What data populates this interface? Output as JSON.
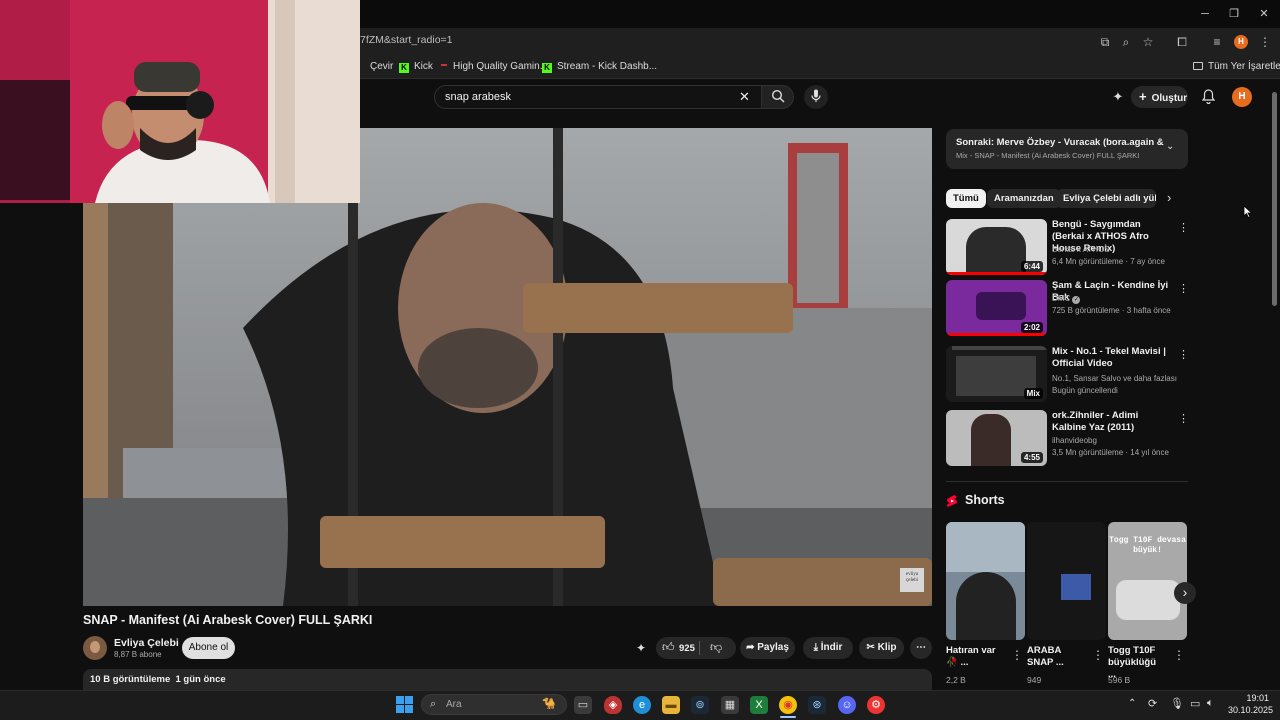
{
  "browser": {
    "url": "7fZM&start_radio=1",
    "bookmarks": [
      "Çevir",
      "Kick",
      "High Quality Gamin...",
      "Stream - Kick Dashb..."
    ],
    "all_bookmarks": "Tüm Yer İşaretleri",
    "profile_initial": "H"
  },
  "youtube": {
    "search_value": "snap arabesk",
    "create_label": "Oluştur",
    "avatar_initial": "H"
  },
  "video": {
    "title": "SNAP - Manifest (Ai Arabesk Cover) FULL ŞARKI",
    "channel": "Evliya Çelebi",
    "subscribers": "8,87 B abone",
    "subscribe_label": "Abone ol",
    "likes": "925",
    "share_label": "Paylaş",
    "download_label": "İndir",
    "clip_label": "Klip",
    "views_date": "10 B görüntüleme  1 gün önce"
  },
  "sidebar": {
    "next_title": "Sonraki: Merve Özbey - Vuracak (bora.again & ATE...",
    "next_sub": "Mix - SNAP - Manifest (Ai Arabesk Cover) FULL ŞARKI",
    "chips": [
      "Tümü",
      "Aramanızdan",
      "Evliya Çelebi adlı yükleyi"
    ],
    "recs": [
      {
        "title": "Bengü - Saygımdan (Berkai x ATHOS Afro House Remix)",
        "channel": "Berkai x ATHOS",
        "meta": "6,4 Mn görüntüleme · 7 ay önce",
        "duration": "6:44"
      },
      {
        "title": "Şam & Laçin - Kendine İyi Bak",
        "channel": "DMC",
        "meta": "725 B görüntüleme · 3 hafta önce",
        "duration": "2:02"
      },
      {
        "title": "Mix - No.1 - Tekel Mavisi | Official Video",
        "channel": "No.1, Sansar Salvo ve daha fazlası",
        "meta": "Bugün güncellendi",
        "duration": "Mix"
      },
      {
        "title": "ork.Zihniler - Adimi Kalbine Yaz (2011)",
        "channel": "ilhanvideobg",
        "meta": "3,5 Mn görüntüleme · 14 yıl önce",
        "duration": "4:55"
      }
    ],
    "shorts_heading": "Shorts",
    "shorts": [
      {
        "title": "Hatıran var 🥀 ...",
        "views": "2,2 B"
      },
      {
        "title": "ARABA SNAP ...",
        "views": "949"
      },
      {
        "title": "Togg T10F büyüklüğü ...",
        "views": "596 B"
      }
    ],
    "short3_overlay": "Togg T10F devasa büyük!"
  },
  "player_watermark": "evliya çelebi",
  "taskbar": {
    "search_placeholder": "Ara",
    "time": "19:01",
    "date": "30.10.2025"
  }
}
